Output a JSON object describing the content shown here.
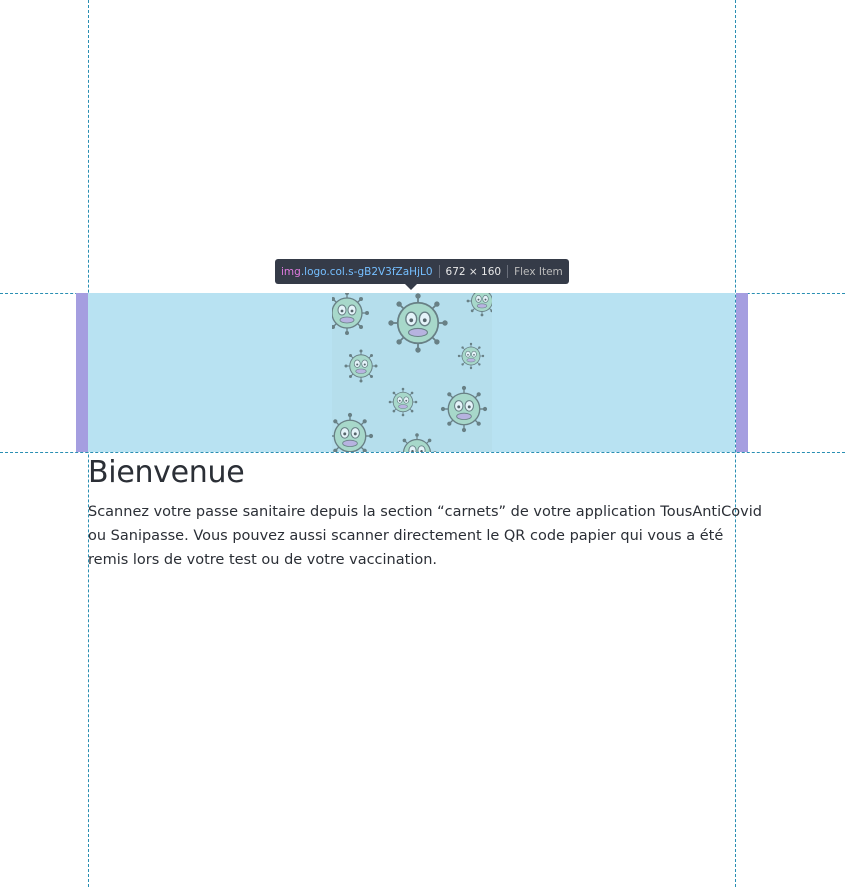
{
  "inspector": {
    "tooltip": {
      "tag": "img",
      "classes": ".logo.col.s-gB2V3fZaHjL0",
      "dimensions": "672 × 160",
      "kind": "Flex Item"
    },
    "colors": {
      "guide": "#2a8fb3",
      "content_highlight": "#b8e2f2",
      "margin_highlight": "#a59ee0",
      "tooltip_bg": "#353b48"
    }
  },
  "main": {
    "logo_alt": "virus illustration logo",
    "title": "Bienvenue",
    "description": "Scannez votre passe sanitaire depuis la section “carnets” de votre application TousAntiCovid ou Sanipasse. Vous pouvez aussi scanner directement le QR code papier qui vous a été remis lors de votre test ou de votre vaccination."
  }
}
